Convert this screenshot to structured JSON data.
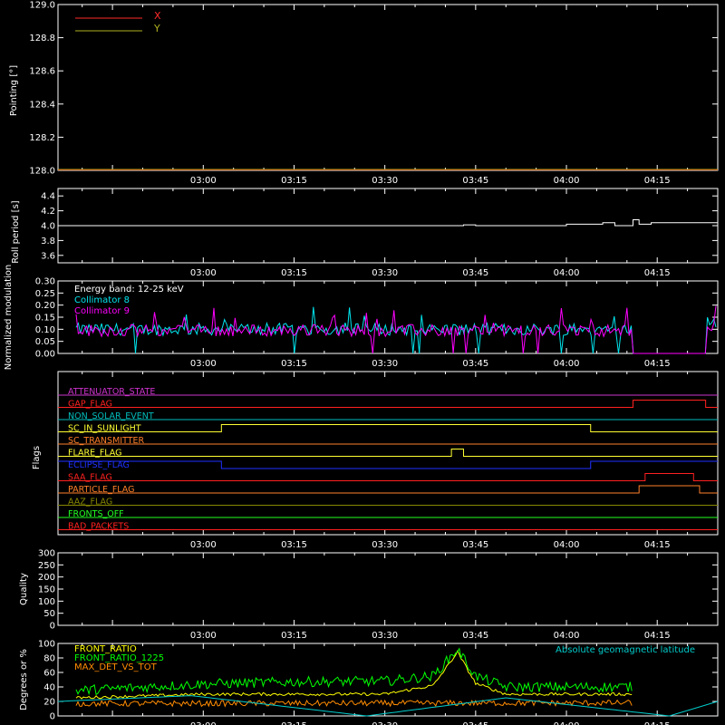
{
  "colors": {
    "background": "#000000",
    "frame": "#ffffff",
    "x": "#ff2a2a",
    "y": "#b0b020",
    "roll": "#ffffff",
    "energy": "#ffffff",
    "coll8": "#00e5ee",
    "coll9": "#ff00ff",
    "front_ratio": "#ffff00",
    "front_ratio_1225": "#00ff00",
    "max_det": "#ff8c00",
    "geolat": "#00cccc"
  },
  "time_axis": {
    "ticks": [
      "03:00",
      "03:15",
      "03:30",
      "03:45",
      "04:00",
      "04:15"
    ]
  },
  "chart_data": [
    {
      "type": "line",
      "panel": "pointing",
      "ylabel": "Pointing [°]",
      "ylim": [
        128.0,
        129.0
      ],
      "yticks": [
        "128.0",
        "128.2",
        "128.4",
        "128.6",
        "128.8",
        "129.0"
      ],
      "legend_position": "top-left",
      "series": [
        {
          "name": "X",
          "color": "#ff2a2a",
          "x": [
            "02:36",
            "04:25"
          ],
          "y": [
            128.0,
            128.0
          ]
        },
        {
          "name": "Y",
          "color": "#b0b020",
          "x": [
            "02:36",
            "04:25"
          ],
          "y": [
            128.0,
            128.0
          ]
        }
      ]
    },
    {
      "type": "line",
      "panel": "roll",
      "ylabel": "Roll period [s]",
      "ylim": [
        3.5,
        4.5
      ],
      "yticks": [
        "3.6",
        "3.8",
        "4.0",
        "4.2",
        "4.4"
      ],
      "series": [
        {
          "name": "",
          "color": "#ffffff",
          "x": [
            "02:36",
            "03:00",
            "03:43",
            "03:45",
            "04:00",
            "04:06",
            "04:08",
            "04:11",
            "04:12",
            "04:14",
            "04:25"
          ],
          "y": [
            4.0,
            4.0,
            4.01,
            4.0,
            4.02,
            4.04,
            4.0,
            4.08,
            4.02,
            4.04,
            4.02
          ]
        }
      ]
    },
    {
      "type": "line",
      "panel": "modulation",
      "ylabel": "Normalized modulation",
      "ylim": [
        0.0,
        0.3
      ],
      "yticks": [
        "0.00",
        "0.05",
        "0.10",
        "0.15",
        "0.20",
        "0.25",
        "0.30"
      ],
      "legend_position": "top-left",
      "legend": [
        "Energy band: 12-25 keV",
        "Collimator 8",
        "Collimator 9"
      ],
      "series": [
        {
          "name": "Collimator 8",
          "color": "#00e5ee",
          "x": [
            "02:39",
            "04:11",
            "04:11",
            "04:23",
            "04:23",
            "04:25"
          ],
          "y": [
            0.1,
            0.1,
            0.0,
            0.0,
            0.12,
            0.12
          ]
        },
        {
          "name": "Collimator 9",
          "color": "#ff00ff",
          "x": [
            "02:39",
            "04:11",
            "04:11",
            "04:23",
            "04:23",
            "04:25"
          ],
          "y": [
            0.095,
            0.095,
            0.0,
            0.0,
            0.11,
            0.11
          ]
        }
      ]
    },
    {
      "type": "line",
      "panel": "flags",
      "ylabel": "Flags",
      "flags": [
        {
          "name": "ATTENUATOR_STATE",
          "color": "#cc33cc",
          "steps": [
            [
              "02:36",
              0
            ]
          ]
        },
        {
          "name": "GAP_FLAG",
          "color": "#ff2020",
          "steps": [
            [
              "02:36",
              0
            ],
            [
              "04:11",
              1
            ],
            [
              "04:23",
              0
            ]
          ]
        },
        {
          "name": "NON_SOLAR_EVENT",
          "color": "#00bbbb",
          "steps": [
            [
              "02:36",
              0
            ]
          ]
        },
        {
          "name": "SC_IN_SUNLIGHT",
          "color": "#ffff33",
          "steps": [
            [
              "02:36",
              0
            ],
            [
              "03:03",
              1
            ],
            [
              "04:04",
              0
            ]
          ]
        },
        {
          "name": "SC_TRANSMITTER",
          "color": "#ff7f2a",
          "steps": [
            [
              "02:36",
              0
            ]
          ]
        },
        {
          "name": "FLARE_FLAG",
          "color": "#ffff33",
          "steps": [
            [
              "02:36",
              0
            ],
            [
              "03:41",
              1
            ],
            [
              "03:43",
              0
            ]
          ]
        },
        {
          "name": "ECLIPSE_FLAG",
          "color": "#2030ff",
          "steps": [
            [
              "02:36",
              1
            ],
            [
              "03:03",
              0
            ],
            [
              "04:04",
              1
            ]
          ]
        },
        {
          "name": "SAA_FLAG",
          "color": "#ff2020",
          "steps": [
            [
              "02:36",
              0
            ],
            [
              "04:13",
              1
            ],
            [
              "04:21",
              0
            ]
          ]
        },
        {
          "name": "PARTICLE_FLAG",
          "color": "#ff7f2a",
          "steps": [
            [
              "02:36",
              0
            ],
            [
              "04:12",
              1
            ],
            [
              "04:22",
              0
            ]
          ]
        },
        {
          "name": "AAZ_FLAG",
          "color": "#888800",
          "steps": [
            [
              "02:36",
              0
            ]
          ]
        },
        {
          "name": "FRONTS_OFF",
          "color": "#22ff22",
          "steps": [
            [
              "02:36",
              0
            ]
          ]
        },
        {
          "name": "BAD_PACKETS",
          "color": "#ff2020",
          "steps": [
            [
              "02:36",
              0
            ]
          ]
        }
      ]
    },
    {
      "type": "line",
      "panel": "quality",
      "ylabel": "Quality",
      "ylim": [
        0,
        300
      ],
      "yticks": [
        "0",
        "50",
        "100",
        "150",
        "200",
        "250",
        "300"
      ],
      "series": []
    },
    {
      "type": "line",
      "panel": "ratios",
      "ylabel": "Degrees or %",
      "ylim": [
        0,
        100
      ],
      "yticks": [
        "0",
        "20",
        "40",
        "60",
        "80",
        "100"
      ],
      "legend_position": "top-left",
      "right_legend": "Absolute geomagnetic latitude",
      "series": [
        {
          "name": "FRONT_RATIO",
          "color": "#ffff00",
          "x": [
            "02:39",
            "03:00",
            "03:30",
            "03:38",
            "03:42",
            "03:45",
            "03:50",
            "04:11"
          ],
          "y": [
            25,
            30,
            30,
            42,
            88,
            45,
            30,
            30
          ]
        },
        {
          "name": "FRONT_RATIO_1225",
          "color": "#00ff00",
          "x": [
            "02:39",
            "03:00",
            "03:15",
            "03:30",
            "03:38",
            "03:42",
            "03:45",
            "03:50",
            "04:00",
            "04:11"
          ],
          "y": [
            35,
            44,
            47,
            48,
            55,
            92,
            55,
            40,
            40,
            40
          ]
        },
        {
          "name": "MAX_DET_VS_TOT",
          "color": "#ff8c00",
          "x": [
            "02:39",
            "04:11"
          ],
          "y": [
            17,
            18
          ]
        },
        {
          "name": "Absolute geomagnetic latitude",
          "color": "#00cccc",
          "x": [
            "02:36",
            "02:58",
            "03:27",
            "03:50",
            "04:17",
            "04:25"
          ],
          "y": [
            20,
            28,
            0,
            25,
            0,
            20
          ]
        }
      ]
    }
  ]
}
